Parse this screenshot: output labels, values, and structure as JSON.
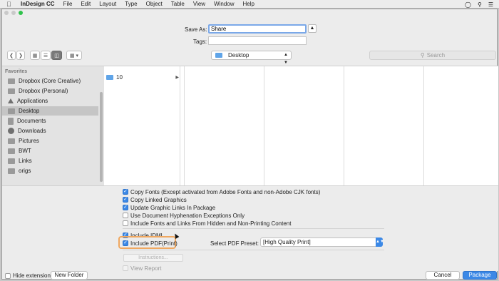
{
  "menubar": {
    "app": "InDesign CC",
    "items": [
      "File",
      "Edit",
      "Layout",
      "Type",
      "Object",
      "Table",
      "View",
      "Window",
      "Help"
    ]
  },
  "save": {
    "label": "Save As:",
    "value": "Share",
    "tags_label": "Tags:",
    "tags_value": ""
  },
  "toolbar": {
    "location": "Desktop",
    "search_placeholder": "Search"
  },
  "sidebar": {
    "heading": "Favorites",
    "items": [
      {
        "label": "Dropbox (Core Creative)",
        "icon": "folder-icon"
      },
      {
        "label": "Dropbox (Personal)",
        "icon": "folder-icon"
      },
      {
        "label": "Applications",
        "icon": "applications-icon"
      },
      {
        "label": "Desktop",
        "icon": "desktop-icon",
        "selected": true
      },
      {
        "label": "Documents",
        "icon": "document-icon"
      },
      {
        "label": "Downloads",
        "icon": "download-icon"
      },
      {
        "label": "Pictures",
        "icon": "folder-icon"
      },
      {
        "label": "BWT",
        "icon": "folder-icon"
      },
      {
        "label": "Links",
        "icon": "folder-icon"
      },
      {
        "label": "origs",
        "icon": "folder-icon"
      }
    ]
  },
  "browser": {
    "column1": [
      {
        "label": "10"
      }
    ]
  },
  "options": {
    "copy_fonts": "Copy Fonts (Except activated from Adobe Fonts and non-Adobe CJK fonts)",
    "copy_graphics": "Copy Linked Graphics",
    "update_links": "Update Graphic Links In Package",
    "hyphenation": "Use Document Hyphenation Exceptions Only",
    "hidden_content": "Include Fonts and Links From Hidden and Non-Printing Content",
    "include_idml": "Include IDML",
    "include_pdf": "Include PDF(Print)",
    "pdf_preset_label": "Select PDF Preset:",
    "pdf_preset_value": "[High Quality Print]",
    "instructions": "Instructions...",
    "view_report": "View Report"
  },
  "bottom": {
    "hide_extension": "Hide extension",
    "new_folder": "New Folder",
    "cancel": "Cancel",
    "package": "Package"
  },
  "colors": {
    "accent": "#3b88e6",
    "highlight": "#f0a860"
  }
}
